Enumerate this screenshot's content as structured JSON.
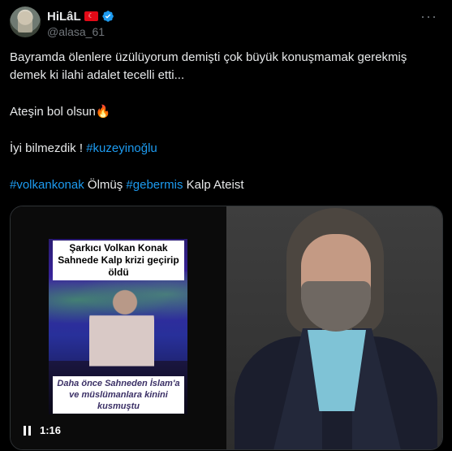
{
  "author": {
    "display_name": "HiLâL",
    "handle": "@alasa_61",
    "flag_emoji": "🇹🇷",
    "verified": true
  },
  "tweet": {
    "line1": "Bayramda ölenlere üzülüyorum demişti çok büyük konuşmamak gerekmiş demek ki ilahi adalet tecelli etti...",
    "line2_text": "Ateşin bol olsun",
    "line2_emoji": "🔥",
    "line3_text": "İyi bilmezdik ! ",
    "line3_hashtag": "#kuzeyinoğlu",
    "line4": {
      "hashtag1": "#volkankonak",
      "word1": " Ölmüş ",
      "hashtag2": "#gebermis",
      "word2": " Kalp Ateist"
    }
  },
  "media": {
    "video_caption_top": "Şarkıcı Volkan Konak Sahnede Kalp krizi geçirip öldü",
    "video_caption_bottom": "Daha önce Sahneden İslam'a ve müslümanlara kinini kusmuştu",
    "video_time": "1:16"
  },
  "icons": {
    "more": "more-options-icon",
    "verified": "verified-badge-icon",
    "pause": "pause-icon"
  },
  "colors": {
    "background": "#000000",
    "text": "#e7e9ea",
    "secondary": "#71767b",
    "link": "#1d9bf0",
    "border": "#2f3336"
  }
}
